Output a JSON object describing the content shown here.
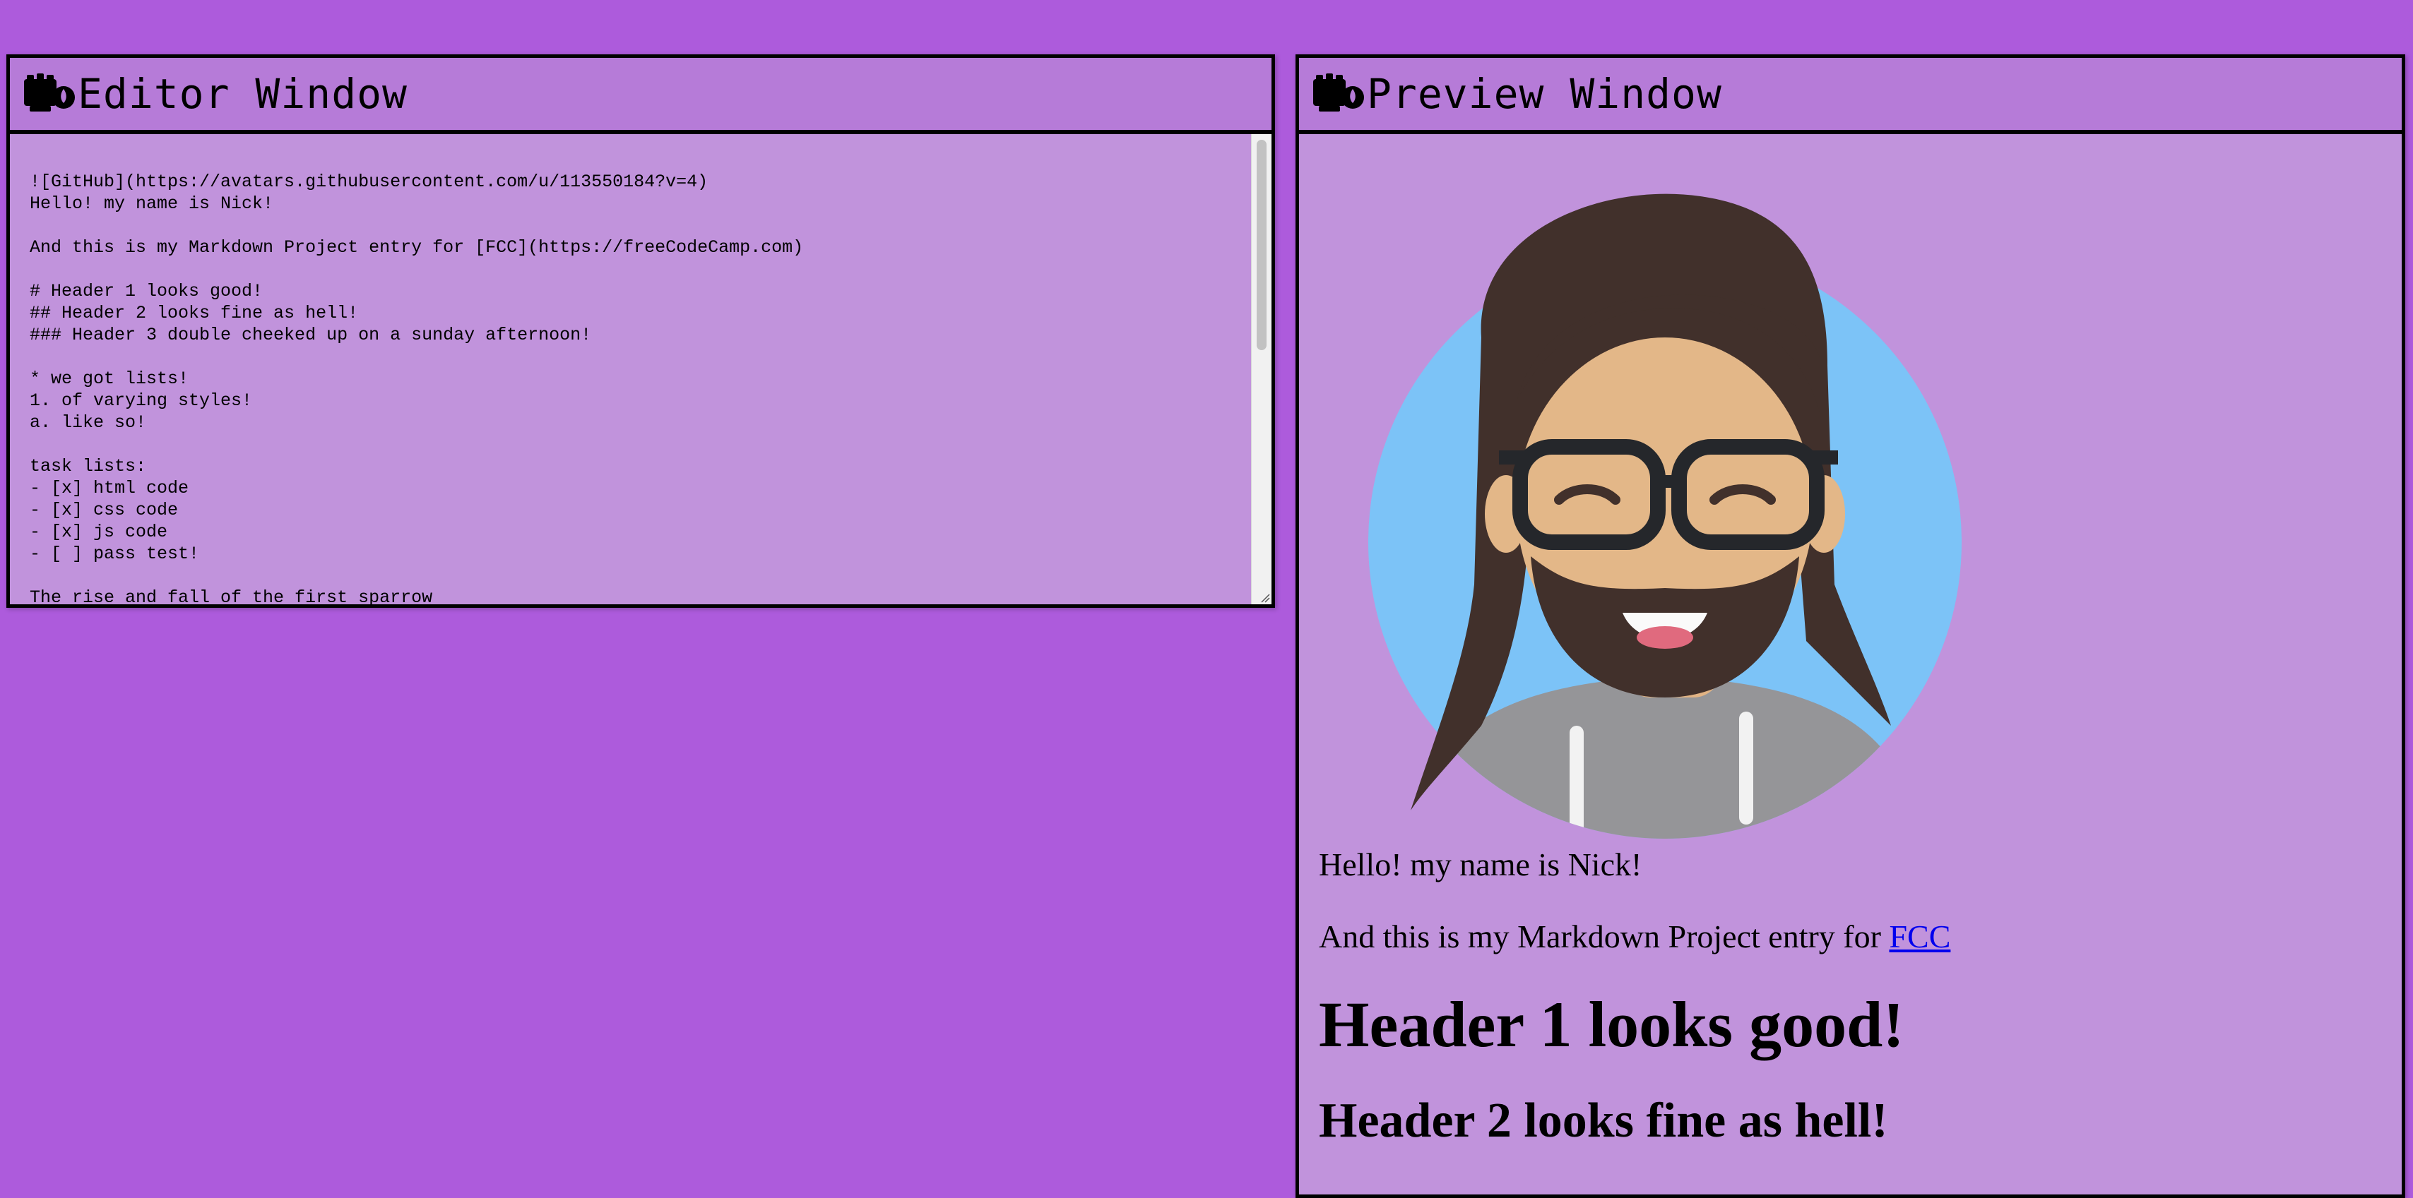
{
  "editor": {
    "title": "Editor Window",
    "content": "![GitHub](https://avatars.githubusercontent.com/u/113550184?v=4)\nHello! my name is Nick!\n\nAnd this is my Markdown Project entry for [FCC](https://freeCodeCamp.com)\n\n# Header 1 looks good!\n## Header 2 looks fine as hell!\n### Header 3 double cheeked up on a sunday afternoon!\n\n* we got lists!\n1. of varying styles!\na. like so!\n\ntask lists:\n- [x] html code\n- [x] css code\n- [x] js code\n- [ ] pass test!\n\nThe rise and fall of the first sparrow"
  },
  "preview": {
    "title": "Preview Window",
    "avatar_alt": "GitHub",
    "hello": "Hello! my name is Nick!",
    "entry_prefix": "And this is my Markdown Project entry for ",
    "entry_link": "FCC",
    "h1": "Header 1 looks good!",
    "h2": "Header 2 looks fine as hell!"
  },
  "icons": {
    "toolbar_logo": "freecodecamp-icon"
  },
  "colors": {
    "page_background": "#ad5bdc",
    "pane_background": "#c193dc",
    "toolbar_background": "#b67bd8",
    "link": "#0000ee"
  }
}
